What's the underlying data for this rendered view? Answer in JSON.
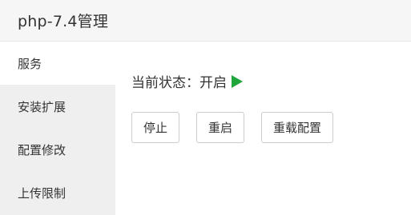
{
  "header": {
    "title": "php-7.4管理"
  },
  "sidebar": {
    "items": [
      {
        "label": "服务",
        "active": true
      },
      {
        "label": "安装扩展",
        "active": false
      },
      {
        "label": "配置修改",
        "active": false
      },
      {
        "label": "上传限制",
        "active": false
      }
    ]
  },
  "main": {
    "status_label": "当前状态：",
    "status_value": "开启",
    "status_icon": "play-icon",
    "status_color": "#20a53a",
    "buttons": {
      "stop": "停止",
      "restart": "重启",
      "reload": "重载配置"
    }
  }
}
